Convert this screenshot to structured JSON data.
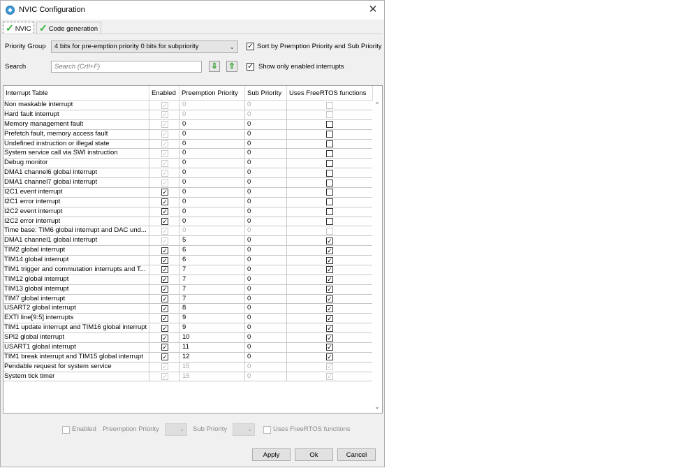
{
  "window": {
    "title": "NVIC Configuration",
    "close_glyph": "✕"
  },
  "tabs": [
    {
      "label": "NVIC",
      "icon": "green-check-icon"
    },
    {
      "label": "Code generation",
      "icon": "green-check-icon"
    }
  ],
  "controls": {
    "priority_group_label": "Priority Group",
    "priority_group_value": "4 bits for pre-emption priority 0 bits for subpriority",
    "sort_label": "Sort by Premption Priority and Sub Priority",
    "sort_checked": true,
    "search_label": "Search",
    "search_placeholder": "Search (Crtl+F)",
    "show_enabled_label": "Show only enabled interrupts",
    "show_enabled_checked": true
  },
  "table": {
    "headers": [
      "Interrupt Table",
      "Enabled",
      "Preemption Priority",
      "Sub Priority",
      "Uses FreeRTOS functions"
    ],
    "rows": [
      {
        "name": "Non maskable interrupt",
        "enabled": true,
        "en_dis": true,
        "pre": "0",
        "sub": "0",
        "num_dis": true,
        "rtos": false,
        "rtos_dis": true
      },
      {
        "name": "Hard fault interrupt",
        "enabled": true,
        "en_dis": true,
        "pre": "0",
        "sub": "0",
        "num_dis": true,
        "rtos": false,
        "rtos_dis": true
      },
      {
        "name": "Memory management fault",
        "enabled": true,
        "en_dis": true,
        "pre": "0",
        "sub": "0",
        "num_dis": false,
        "rtos": false,
        "rtos_dis": false
      },
      {
        "name": "Prefetch fault, memory access fault",
        "enabled": true,
        "en_dis": true,
        "pre": "0",
        "sub": "0",
        "num_dis": false,
        "rtos": false,
        "rtos_dis": false
      },
      {
        "name": "Undefined instruction or illegal state",
        "enabled": true,
        "en_dis": true,
        "pre": "0",
        "sub": "0",
        "num_dis": false,
        "rtos": false,
        "rtos_dis": false
      },
      {
        "name": "System service call via SWI instruction",
        "enabled": true,
        "en_dis": true,
        "pre": "0",
        "sub": "0",
        "num_dis": false,
        "rtos": false,
        "rtos_dis": false
      },
      {
        "name": "Debug monitor",
        "enabled": true,
        "en_dis": true,
        "pre": "0",
        "sub": "0",
        "num_dis": false,
        "rtos": false,
        "rtos_dis": false
      },
      {
        "name": "DMA1 channel6 global interrupt",
        "enabled": true,
        "en_dis": true,
        "pre": "0",
        "sub": "0",
        "num_dis": false,
        "rtos": false,
        "rtos_dis": false
      },
      {
        "name": "DMA1 channel7 global interrupt",
        "enabled": true,
        "en_dis": true,
        "pre": "0",
        "sub": "0",
        "num_dis": false,
        "rtos": false,
        "rtos_dis": false
      },
      {
        "name": "I2C1 event interrupt",
        "enabled": true,
        "en_dis": false,
        "pre": "0",
        "sub": "0",
        "num_dis": false,
        "rtos": false,
        "rtos_dis": false
      },
      {
        "name": "I2C1 error interrupt",
        "enabled": true,
        "en_dis": false,
        "pre": "0",
        "sub": "0",
        "num_dis": false,
        "rtos": false,
        "rtos_dis": false
      },
      {
        "name": "I2C2 event interrupt",
        "enabled": true,
        "en_dis": false,
        "pre": "0",
        "sub": "0",
        "num_dis": false,
        "rtos": false,
        "rtos_dis": false
      },
      {
        "name": "I2C2 error interrupt",
        "enabled": true,
        "en_dis": false,
        "pre": "0",
        "sub": "0",
        "num_dis": false,
        "rtos": false,
        "rtos_dis": false
      },
      {
        "name": "Time base: TIM6 global interrupt and DAC und...",
        "enabled": true,
        "en_dis": true,
        "pre": "0",
        "sub": "0",
        "num_dis": true,
        "rtos": false,
        "rtos_dis": true
      },
      {
        "name": "DMA1 channel1 global interrupt",
        "enabled": true,
        "en_dis": true,
        "pre": "5",
        "sub": "0",
        "num_dis": false,
        "rtos": true,
        "rtos_dis": false
      },
      {
        "name": "TIM2 global interrupt",
        "enabled": true,
        "en_dis": false,
        "pre": "6",
        "sub": "0",
        "num_dis": false,
        "rtos": true,
        "rtos_dis": false
      },
      {
        "name": "TIM14 global interrupt",
        "enabled": true,
        "en_dis": false,
        "pre": "6",
        "sub": "0",
        "num_dis": false,
        "rtos": true,
        "rtos_dis": false
      },
      {
        "name": "TIM1 trigger and commutation interrupts and T...",
        "enabled": true,
        "en_dis": false,
        "pre": "7",
        "sub": "0",
        "num_dis": false,
        "rtos": true,
        "rtos_dis": false
      },
      {
        "name": "TIM12 global interrupt",
        "enabled": true,
        "en_dis": false,
        "pre": "7",
        "sub": "0",
        "num_dis": false,
        "rtos": true,
        "rtos_dis": false
      },
      {
        "name": "TIM13 global interrupt",
        "enabled": true,
        "en_dis": false,
        "pre": "7",
        "sub": "0",
        "num_dis": false,
        "rtos": true,
        "rtos_dis": false
      },
      {
        "name": "TIM7 global interrupt",
        "enabled": true,
        "en_dis": false,
        "pre": "7",
        "sub": "0",
        "num_dis": false,
        "rtos": true,
        "rtos_dis": false
      },
      {
        "name": "USART2 global interrupt",
        "enabled": true,
        "en_dis": false,
        "pre": "8",
        "sub": "0",
        "num_dis": false,
        "rtos": true,
        "rtos_dis": false
      },
      {
        "name": "EXTI line[9:5] interrupts",
        "enabled": true,
        "en_dis": false,
        "pre": "9",
        "sub": "0",
        "num_dis": false,
        "rtos": true,
        "rtos_dis": false
      },
      {
        "name": "TIM1 update interrupt and TIM16 global interrupt",
        "enabled": true,
        "en_dis": false,
        "pre": "9",
        "sub": "0",
        "num_dis": false,
        "rtos": true,
        "rtos_dis": false
      },
      {
        "name": "SPI2 global interrupt",
        "enabled": true,
        "en_dis": false,
        "pre": "10",
        "sub": "0",
        "num_dis": false,
        "rtos": true,
        "rtos_dis": false
      },
      {
        "name": "USART1 global interrupt",
        "enabled": true,
        "en_dis": false,
        "pre": "11",
        "sub": "0",
        "num_dis": false,
        "rtos": true,
        "rtos_dis": false
      },
      {
        "name": "TIM1 break interrupt and TIM15 global interrupt",
        "enabled": true,
        "en_dis": false,
        "pre": "12",
        "sub": "0",
        "num_dis": false,
        "rtos": true,
        "rtos_dis": false
      },
      {
        "name": "Pendable request for system service",
        "enabled": true,
        "en_dis": true,
        "pre": "15",
        "sub": "0",
        "num_dis": true,
        "rtos": true,
        "rtos_dis": true
      },
      {
        "name": "System tick timer",
        "enabled": true,
        "en_dis": true,
        "pre": "15",
        "sub": "0",
        "num_dis": true,
        "rtos": true,
        "rtos_dis": true
      }
    ]
  },
  "bottom": {
    "enabled_label": "Enabled",
    "preemption_label": "Preemption Priority",
    "sub_label": "Sub Priority",
    "freertos_label": "Uses FreeRTOS functions"
  },
  "buttons": {
    "apply": "Apply",
    "ok": "Ok",
    "cancel": "Cancel"
  },
  "glyphs": {
    "check": "✓",
    "arrow_down": "⌄",
    "scroll_up": "⌃",
    "scroll_down": "⌄",
    "move_down": "⇩",
    "move_up": "⇧"
  }
}
